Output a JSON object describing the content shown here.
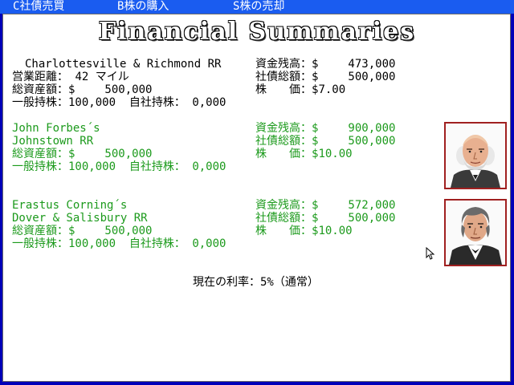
{
  "menu": {
    "items": [
      {
        "key": "C",
        "label": "社債売買"
      },
      {
        "key": "B",
        "label": "株の購入"
      },
      {
        "key": "S",
        "label": "株の売却"
      }
    ]
  },
  "screen": {
    "title": "Financial Summaries"
  },
  "player": {
    "railroad": "Charlottesville & Richmond RR",
    "distance_label": "営業距離：",
    "distance_value": "42",
    "distance_unit": "マイル",
    "assets_label": "総資産額：$",
    "assets_value": "500,000",
    "public_label": "一般持株：",
    "public_value": "100,000",
    "company_label": "自社持株：",
    "company_value": "0,000",
    "cash_label": "資金残高：$",
    "cash_value": "473,000",
    "bonds_label": "社債総額：$",
    "bonds_value": "500,000",
    "price_label": "株　　価：$",
    "price_value": "7.00"
  },
  "rivals": [
    {
      "owner": "John Forbes´s",
      "railroad": "Johnstown RR",
      "assets_label": "総資産額：$",
      "assets_value": "500,000",
      "public_label": "一般持株：",
      "public_value": "100,000",
      "company_label": "自社持株：",
      "company_value": "0,000",
      "cash_label": "資金残高：$",
      "cash_value": "900,000",
      "bonds_label": "社債総額：$",
      "bonds_value": "500,000",
      "price_label": "株　　価：$",
      "price_value": "10.00",
      "portrait": "john-forbes-portrait"
    },
    {
      "owner": "Erastus Corning´s",
      "railroad": "Dover & Salisbury RR",
      "assets_label": "総資産額：$",
      "assets_value": "500,000",
      "public_label": "一般持株：",
      "public_value": "100,000",
      "company_label": "自社持株：",
      "company_value": "0,000",
      "cash_label": "資金残高：$",
      "cash_value": "572,000",
      "bonds_label": "社債総額：$",
      "bonds_value": "500,000",
      "price_label": "株　　価：$",
      "price_value": "10.00",
      "portrait": "erastus-corning-portrait"
    }
  ],
  "interest": {
    "label": "現在の利率：",
    "value": "5%",
    "note": "（通常）"
  },
  "colors": {
    "menubar": "#1a5cf0",
    "background": "#0000b8",
    "panel": "#ffffff",
    "rival_text": "#1c9a1c",
    "portrait_frame": "#a02020"
  },
  "icons": {
    "pointer": "arrow-cursor-icon"
  }
}
